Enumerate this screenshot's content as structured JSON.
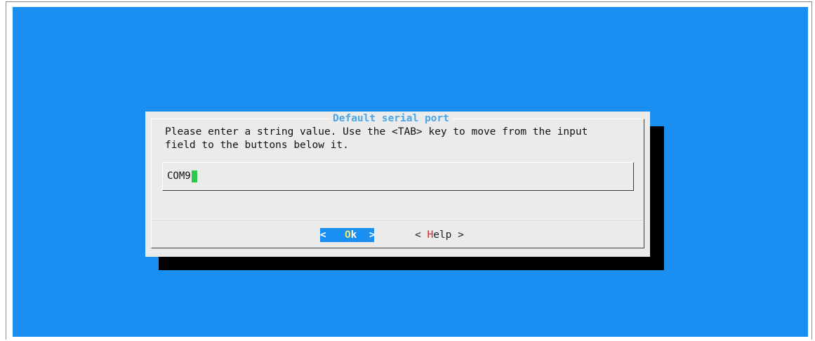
{
  "dialog": {
    "title": "Default serial port",
    "prompt_lines": [
      "Please enter a string value. Use the <TAB> key to move from the input",
      "field to the buttons below it."
    ],
    "input_value": "COM9"
  },
  "buttons": {
    "ok": {
      "left": "< ",
      "hotkey": "O",
      "rest": "k",
      "right": " >"
    },
    "help": {
      "left": "< ",
      "hotkey": "H",
      "rest": "elp",
      "right": " >"
    }
  },
  "colors": {
    "background": "#1a8ff2",
    "dialog": "#ebebeb",
    "title": "#4aa6e8",
    "cursor": "#2cc84a",
    "ok_button_bg": "#1a8ff2",
    "hotkey_help": "#d42a2a",
    "shadow": "#000000"
  }
}
